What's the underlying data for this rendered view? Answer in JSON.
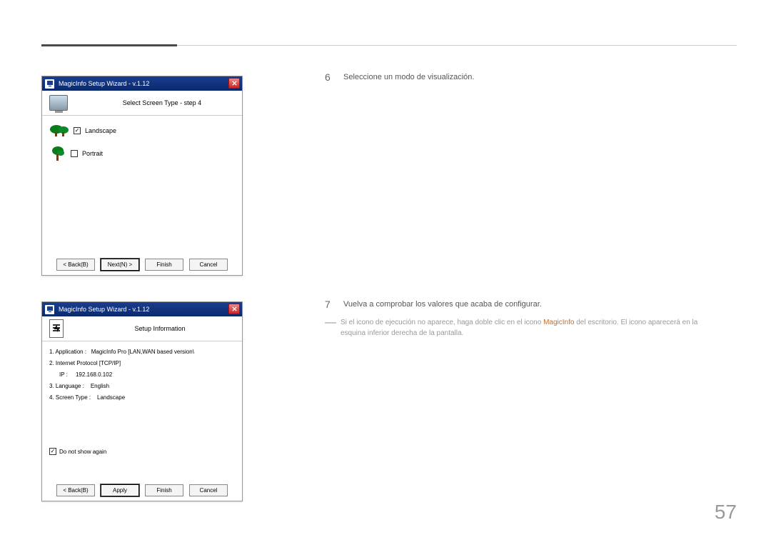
{
  "page_number": "57",
  "wizard_title": "MagicInfo Setup Wizard - v.1.12",
  "step4": {
    "header": "Select Screen Type - step 4",
    "landscape": "Landscape",
    "portrait": "Portrait",
    "landscape_checked": true,
    "portrait_checked": false
  },
  "setup_info": {
    "header": "Setup Information",
    "line1_label": "1. Application :",
    "line1_value": "MagicInfo Pro [LAN,WAN based version\\",
    "line2_label": "2. Internet Protocol [TCP/IP]",
    "ip_label": "IP :",
    "ip_value": "192.168.0.102",
    "line3_label": "3. Language :",
    "line3_value": "English",
    "line4_label": "4. Screen Type :",
    "line4_value": "Landscape",
    "dont_show": "Do not show again"
  },
  "buttons": {
    "back": "< Back(B)",
    "next": "Next(N) >",
    "finish": "Finish",
    "cancel": "Cancel",
    "apply": "Apply"
  },
  "instructions": {
    "n6": "6",
    "t6": "Seleccione un modo de visualización.",
    "n7": "7",
    "t7": "Vuelva a comprobar los valores que acaba de configurar.",
    "note_pre": "Si el icono de ejecución no aparece, haga doble clic en el icono ",
    "note_highlight": "MagicInfo",
    "note_post": " del escritorio. El icono aparecerá en la esquina inferior derecha de la pantalla."
  }
}
